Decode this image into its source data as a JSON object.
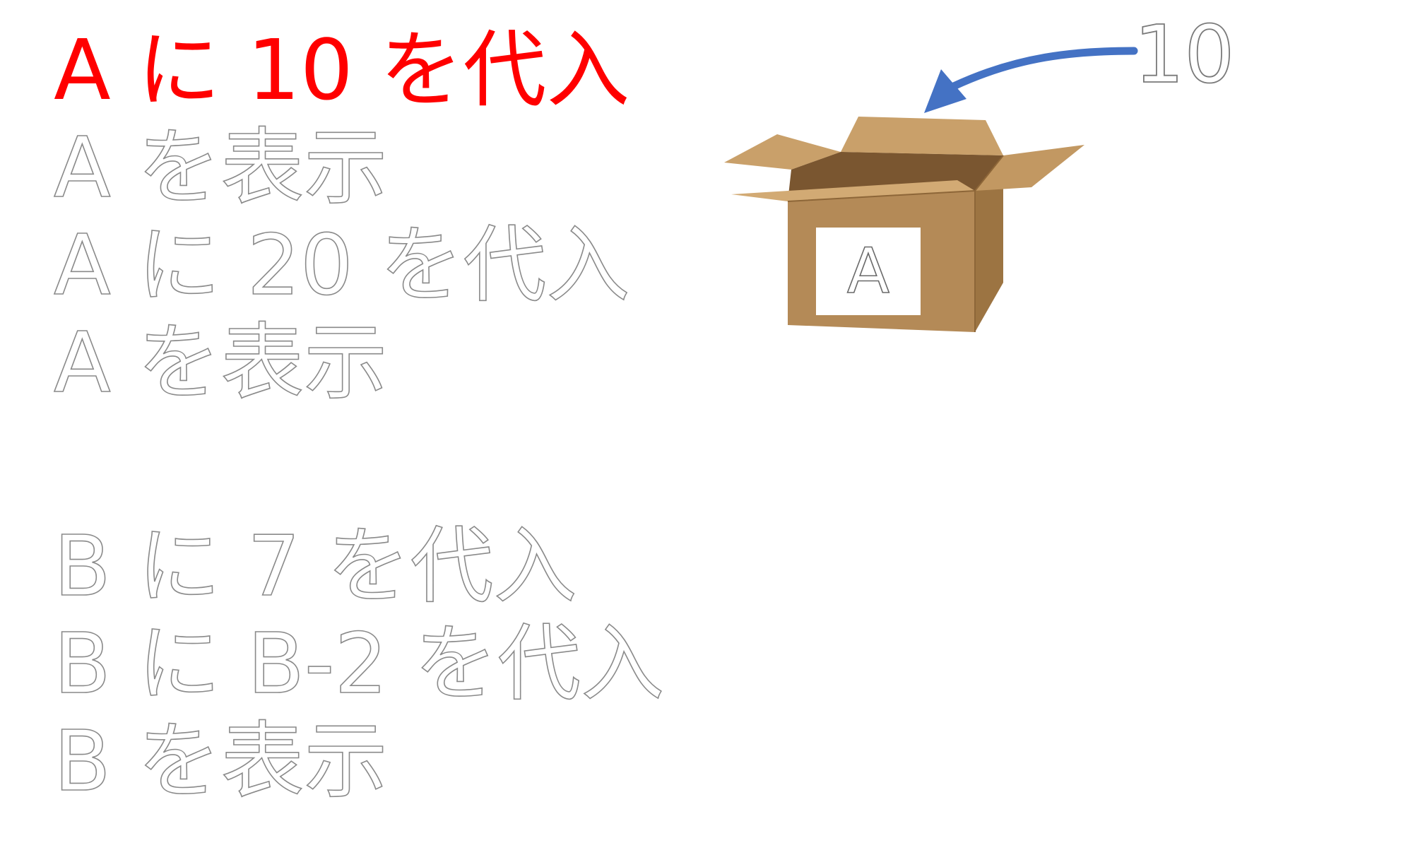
{
  "program": {
    "lines": [
      {
        "text": "A に 10 を代入",
        "state": "active"
      },
      {
        "text": "A を表示",
        "state": "inactive"
      },
      {
        "text": "A に 20 を代入",
        "state": "inactive"
      },
      {
        "text": "A を表示",
        "state": "inactive"
      },
      {
        "text": "B に 7 を代入",
        "state": "inactive"
      },
      {
        "text": "B に B-2 を代入",
        "state": "inactive"
      },
      {
        "text": "B を表示",
        "state": "inactive"
      }
    ]
  },
  "box": {
    "label": "A"
  },
  "incoming_value": "10",
  "colors": {
    "active_text": "#ff0000",
    "outline_text": "#8a8a8a",
    "arrow": "#4472c4",
    "box_front": "#b48a57",
    "box_side": "#9c7442",
    "box_inside": "#6b4a24",
    "box_flap": "#c9a06a"
  }
}
